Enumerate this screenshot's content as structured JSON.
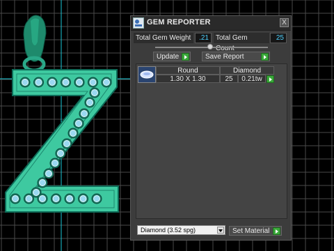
{
  "viewport": {
    "grid_color": "#4a4a4a",
    "axis_color": "#18c8d8",
    "model_color": "#3ec9a0",
    "model_edge_color": "#0e6b58",
    "gem_color": "#9ad8f0"
  },
  "panel": {
    "title": "GEM REPORTER",
    "close_label": "X",
    "total_weight_label": "Total Gem Weight",
    "total_weight_value": ".21",
    "total_count_label": "Total Gem Count",
    "total_count_value": "25",
    "update_label": "Update",
    "save_report_label": "Save Report",
    "table": {
      "headers": [
        "Round",
        "Diamond"
      ],
      "row": {
        "size": "1.30 X 1.30",
        "count": "25",
        "weight": "0.21tw"
      }
    },
    "material_select": "Diamond   (3.52 spg)",
    "set_material_label": "Set Material"
  }
}
